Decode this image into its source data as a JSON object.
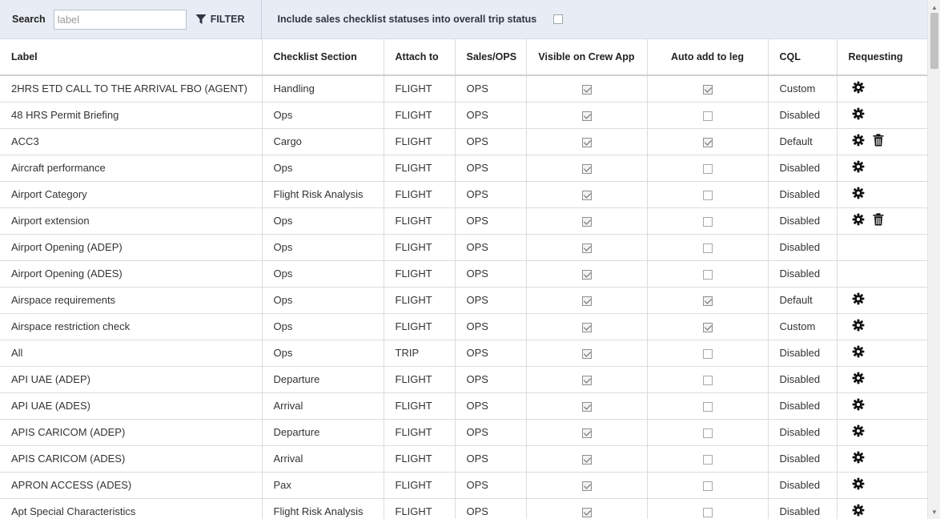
{
  "toolbar": {
    "search_label": "Search",
    "search_placeholder": "label",
    "search_value": "",
    "filter_label": "FILTER",
    "include_label": "Include sales checklist statuses into overall trip status",
    "include_checked": false
  },
  "table": {
    "columns": [
      "Label",
      "Checklist Section",
      "Attach to",
      "Sales/OPS",
      "Visible on Crew App",
      "Auto add to leg",
      "CQL",
      "Requesting"
    ],
    "rows": [
      {
        "label": "2HRS ETD CALL TO THE ARRIVAL FBO (AGENT)",
        "section": "Handling",
        "attach": "FLIGHT",
        "sales_ops": "OPS",
        "visible": true,
        "auto_add": true,
        "cql": "Custom",
        "gear": true,
        "trash": false
      },
      {
        "label": "48 HRS Permit Briefing",
        "section": "Ops",
        "attach": "FLIGHT",
        "sales_ops": "OPS",
        "visible": true,
        "auto_add": false,
        "cql": "Disabled",
        "gear": true,
        "trash": false
      },
      {
        "label": "ACC3",
        "section": "Cargo",
        "attach": "FLIGHT",
        "sales_ops": "OPS",
        "visible": true,
        "auto_add": true,
        "cql": "Default",
        "gear": true,
        "trash": true
      },
      {
        "label": "Aircraft performance",
        "section": "Ops",
        "attach": "FLIGHT",
        "sales_ops": "OPS",
        "visible": true,
        "auto_add": false,
        "cql": "Disabled",
        "gear": true,
        "trash": false
      },
      {
        "label": "Airport Category",
        "section": "Flight Risk Analysis",
        "attach": "FLIGHT",
        "sales_ops": "OPS",
        "visible": true,
        "auto_add": false,
        "cql": "Disabled",
        "gear": true,
        "trash": false
      },
      {
        "label": "Airport extension",
        "section": "Ops",
        "attach": "FLIGHT",
        "sales_ops": "OPS",
        "visible": true,
        "auto_add": false,
        "cql": "Disabled",
        "gear": true,
        "trash": true
      },
      {
        "label": "Airport Opening (ADEP)",
        "section": "Ops",
        "attach": "FLIGHT",
        "sales_ops": "OPS",
        "visible": true,
        "auto_add": false,
        "cql": "Disabled",
        "gear": false,
        "trash": false
      },
      {
        "label": "Airport Opening (ADES)",
        "section": "Ops",
        "attach": "FLIGHT",
        "sales_ops": "OPS",
        "visible": true,
        "auto_add": false,
        "cql": "Disabled",
        "gear": false,
        "trash": false
      },
      {
        "label": "Airspace requirements",
        "section": "Ops",
        "attach": "FLIGHT",
        "sales_ops": "OPS",
        "visible": true,
        "auto_add": true,
        "cql": "Default",
        "gear": true,
        "trash": false
      },
      {
        "label": "Airspace restriction check",
        "section": "Ops",
        "attach": "FLIGHT",
        "sales_ops": "OPS",
        "visible": true,
        "auto_add": true,
        "cql": "Custom",
        "gear": true,
        "trash": false
      },
      {
        "label": "All",
        "section": "Ops",
        "attach": "TRIP",
        "sales_ops": "OPS",
        "visible": true,
        "auto_add": false,
        "cql": "Disabled",
        "gear": true,
        "trash": false
      },
      {
        "label": "API UAE (ADEP)",
        "section": "Departure",
        "attach": "FLIGHT",
        "sales_ops": "OPS",
        "visible": true,
        "auto_add": false,
        "cql": "Disabled",
        "gear": true,
        "trash": false
      },
      {
        "label": "API UAE (ADES)",
        "section": "Arrival",
        "attach": "FLIGHT",
        "sales_ops": "OPS",
        "visible": true,
        "auto_add": false,
        "cql": "Disabled",
        "gear": true,
        "trash": false
      },
      {
        "label": "APIS CARICOM (ADEP)",
        "section": "Departure",
        "attach": "FLIGHT",
        "sales_ops": "OPS",
        "visible": true,
        "auto_add": false,
        "cql": "Disabled",
        "gear": true,
        "trash": false
      },
      {
        "label": "APIS CARICOM (ADES)",
        "section": "Arrival",
        "attach": "FLIGHT",
        "sales_ops": "OPS",
        "visible": true,
        "auto_add": false,
        "cql": "Disabled",
        "gear": true,
        "trash": false
      },
      {
        "label": "APRON ACCESS (ADES)",
        "section": "Pax",
        "attach": "FLIGHT",
        "sales_ops": "OPS",
        "visible": true,
        "auto_add": false,
        "cql": "Disabled",
        "gear": true,
        "trash": false
      },
      {
        "label": "Apt Special Characteristics",
        "section": "Flight Risk Analysis",
        "attach": "FLIGHT",
        "sales_ops": "OPS",
        "visible": true,
        "auto_add": false,
        "cql": "Disabled",
        "gear": true,
        "trash": false
      }
    ]
  },
  "icons": {
    "filter": "filter-icon",
    "gear": "gear-icon",
    "trash": "trash-icon"
  },
  "colors": {
    "toolbar_bg": "#e8edf5",
    "grid_line": "#dcdcdc"
  }
}
